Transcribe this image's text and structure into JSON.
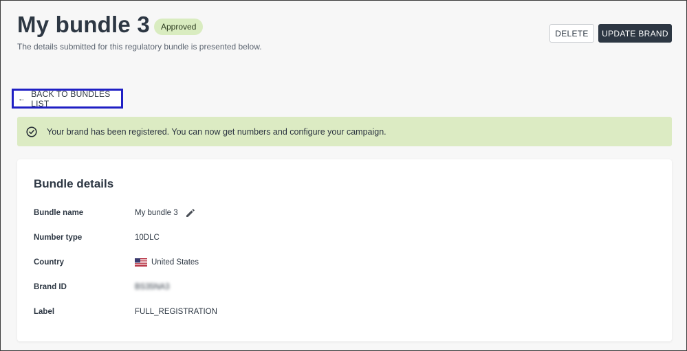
{
  "header": {
    "title": "My bundle 3",
    "status_badge": "Approved",
    "subtitle": "The details submitted for this regulatory bundle is presented below.",
    "delete_label": "DELETE",
    "update_label": "UPDATE BRAND"
  },
  "nav": {
    "back_label": "BACK TO BUNDLES LIST",
    "back_icon": "arrow-left-icon"
  },
  "alert": {
    "icon": "check-circle-icon",
    "message": "Your brand has been registered. You can now get numbers and configure your campaign."
  },
  "details": {
    "title": "Bundle details",
    "rows": [
      {
        "label": "Bundle name",
        "value": "My bundle 3",
        "icon": "pencil-icon"
      },
      {
        "label": "Number type",
        "value": "10DLC"
      },
      {
        "label": "Country",
        "value": "United States",
        "icon": "us-flag-icon"
      },
      {
        "label": "Brand ID",
        "value": "BS35NA3"
      },
      {
        "label": "Label",
        "value": "FULL_REGISTRATION"
      }
    ]
  },
  "colors": {
    "primary_button": "#2d3743",
    "alert_background": "#dcebc3",
    "badge_background": "#d9ecc0",
    "focus_outline": "#1f1fc4"
  }
}
